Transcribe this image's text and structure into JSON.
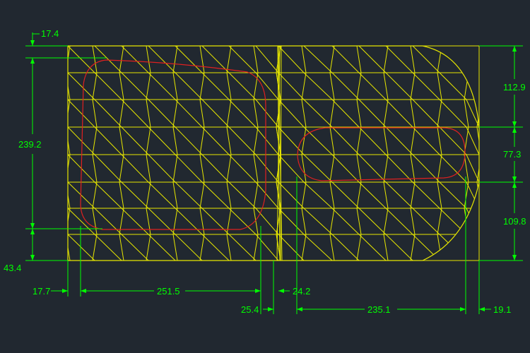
{
  "colors": {
    "background": "#212830",
    "mesh": "#e6e600",
    "dimension": "#00ff00",
    "outline": "#e02020"
  },
  "dimensions": {
    "top_offset": "17.4",
    "left_height": "239.2",
    "bottom_offset": "43.4",
    "left_margin": "17.7",
    "left_region_width": "251.5",
    "gap_left": "25.4",
    "gap_right": "24.2",
    "right_region_width": "235.1",
    "right_margin": "19.1",
    "right_top": "112.9",
    "right_middle": "77.3",
    "right_bottom": "109.8"
  }
}
